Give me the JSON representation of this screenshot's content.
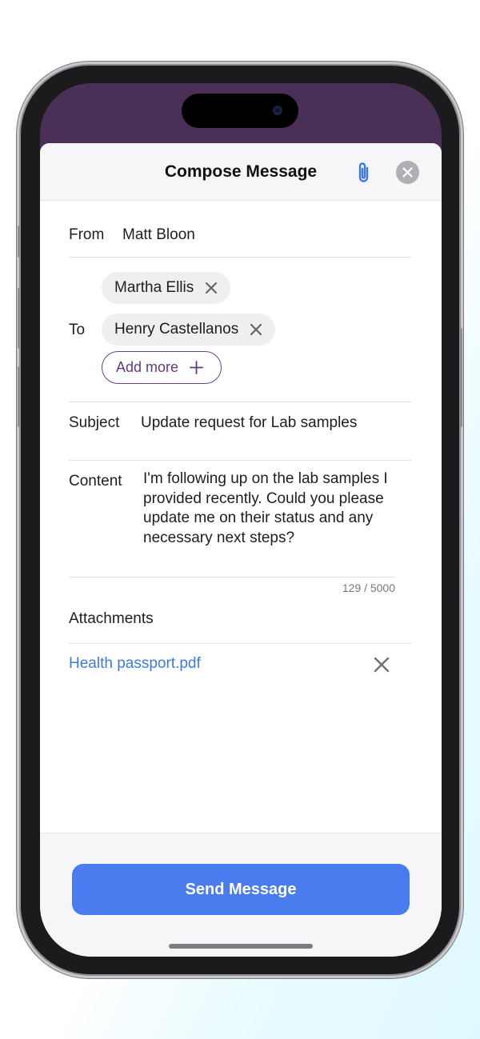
{
  "header": {
    "title": "Compose Message",
    "attach_icon": "paperclip-icon",
    "close_icon": "close-circle-icon"
  },
  "from": {
    "label": "From",
    "value": "Matt Bloon"
  },
  "to": {
    "label": "To",
    "recipients": [
      {
        "name": "Martha Ellis"
      },
      {
        "name": "Henry Castellanos"
      }
    ],
    "add_more_label": "Add more"
  },
  "subject": {
    "label": "Subject",
    "value": "Update request for Lab samples"
  },
  "content": {
    "label": "Content",
    "value": "I'm following up on the lab samples I provided recently. Could you please update me on their status and any necessary next steps?",
    "counter": "129 / 5000"
  },
  "attachments": {
    "title": "Attachments",
    "files": [
      {
        "name": "Health passport.pdf"
      }
    ]
  },
  "footer": {
    "send_label": "Send Message"
  },
  "colors": {
    "accent": "#4a7cf0",
    "link": "#3b7be0",
    "purple": "#6b3f8c",
    "status_bar": "#4a3056"
  }
}
